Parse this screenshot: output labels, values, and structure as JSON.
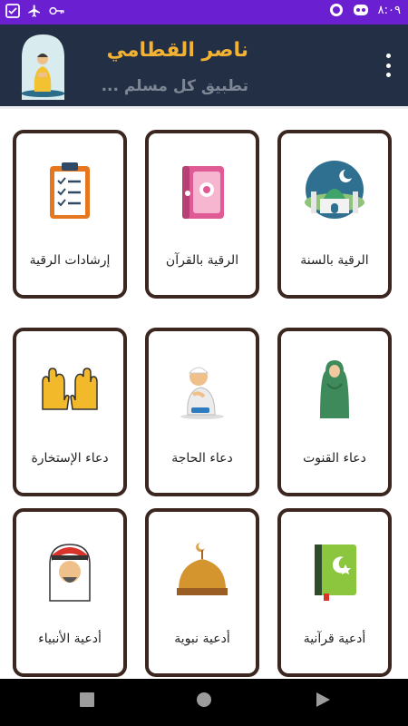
{
  "status_bar": {
    "time": "٨:٠٩"
  },
  "app_bar": {
    "title": "ناصر القطامي",
    "subtitle": "تطبيق كل مسلم ...",
    "menu_icon": "more-vert-icon"
  },
  "cards": [
    {
      "label": "الرقية بالسنة",
      "icon": "mosque-icon"
    },
    {
      "label": "الرقية بالقرآن",
      "icon": "quran-book-icon"
    },
    {
      "label": "إرشادات الرقية",
      "icon": "clipboard-checklist-icon"
    },
    {
      "label": "دعاء القنوت",
      "icon": "praying-woman-icon"
    },
    {
      "label": "دعاء الحاجة",
      "icon": "praying-boy-icon"
    },
    {
      "label": "دعاء الإستخارة",
      "icon": "raised-hands-icon"
    },
    {
      "label": "أدعية قرآنية",
      "icon": "green-quran-icon"
    },
    {
      "label": "أدعية نبوية",
      "icon": "dome-crescent-icon"
    },
    {
      "label": "أدعية الأنبياء",
      "icon": "arab-man-icon"
    }
  ],
  "nav": {
    "recents_icon": "square-icon",
    "home_icon": "circle-icon",
    "back_icon": "triangle-icon"
  }
}
